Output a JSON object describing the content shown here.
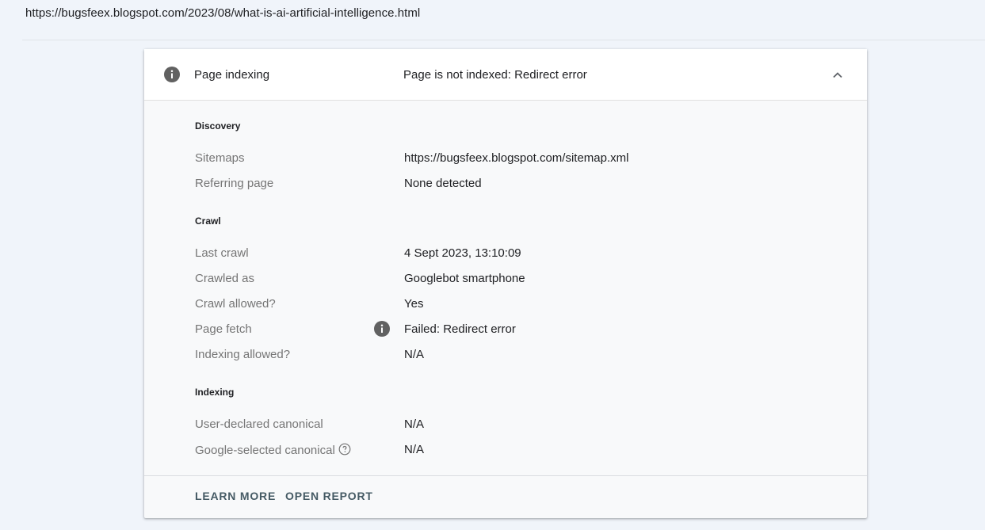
{
  "url": "https://bugsfeex.blogspot.com/2023/08/what-is-ai-artificial-intelligence.html",
  "header": {
    "title": "Page indexing",
    "status": "Page is not indexed: Redirect error",
    "icon": "info-icon",
    "toggle_icon": "chevron-up-icon"
  },
  "discovery": {
    "title": "Discovery",
    "sitemaps_label": "Sitemaps",
    "sitemaps_value": "https://bugsfeex.blogspot.com/sitemap.xml",
    "referring_label": "Referring page",
    "referring_value": "None detected"
  },
  "crawl": {
    "title": "Crawl",
    "last_crawl_label": "Last crawl",
    "last_crawl_value": "4 Sept 2023, 13:10:09",
    "crawled_as_label": "Crawled as",
    "crawled_as_value": "Googlebot smartphone",
    "crawl_allowed_label": "Crawl allowed?",
    "crawl_allowed_value": "Yes",
    "page_fetch_label": "Page fetch",
    "page_fetch_value": "Failed: Redirect error",
    "indexing_allowed_label": "Indexing allowed?",
    "indexing_allowed_value": "N/A"
  },
  "indexing": {
    "title": "Indexing",
    "user_canonical_label": "User-declared canonical",
    "user_canonical_value": "N/A",
    "google_canonical_label": "Google-selected canonical",
    "google_canonical_value": "N/A"
  },
  "actions": {
    "learn_more": "LEARN MORE",
    "open_report": "OPEN REPORT"
  },
  "colors": {
    "page_bg": "#f0f4fa",
    "card_bg": "#f8f9fa",
    "header_bg": "#ffffff",
    "label": "#757575",
    "action": "#455a64",
    "icon": "#616161"
  }
}
